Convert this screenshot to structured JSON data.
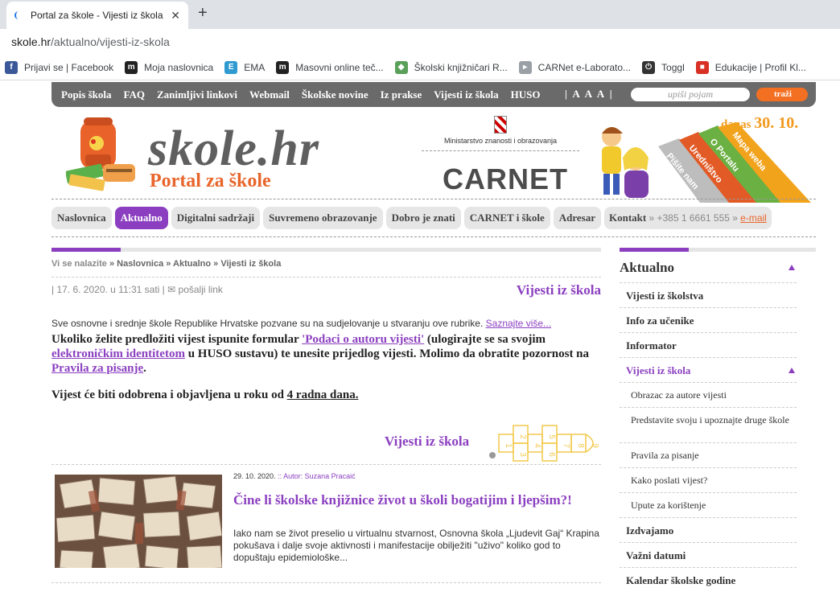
{
  "browser": {
    "tab_title": "Portal za škole - Vijesti iz škola",
    "close_glyph": "✕",
    "new_tab_glyph": "+",
    "url_host": "skole.hr",
    "url_path": "/aktualno/vijesti-iz-skola",
    "bookmarks": [
      {
        "label": "Prijavi se | Facebook",
        "icon": "facebook-icon",
        "color": "#3b5998",
        "glyph": "f"
      },
      {
        "label": "Moja naslovnica",
        "icon": "m-icon",
        "color": "#222222",
        "glyph": "m"
      },
      {
        "label": "EMA",
        "icon": "ema-icon",
        "color": "#2e9ad0",
        "glyph": "E"
      },
      {
        "label": "Masovni online teč...",
        "icon": "m-icon",
        "color": "#222222",
        "glyph": "m"
      },
      {
        "label": "Školski knjižničari R...",
        "icon": "shield-icon",
        "color": "#5aa05a",
        "glyph": "◆"
      },
      {
        "label": "CARNet e-Laborato...",
        "icon": "carnet-icon",
        "color": "#9aa0a6",
        "glyph": "▸"
      },
      {
        "label": "Toggl",
        "icon": "power-icon",
        "color": "#333333",
        "glyph": "⏻"
      },
      {
        "label": "Edukacije | Profil Kl...",
        "icon": "flag-icon",
        "color": "#d93025",
        "glyph": "■"
      }
    ]
  },
  "topnav": {
    "links": [
      "Popis škola",
      "FAQ",
      "Zanimljivi linkovi",
      "Webmail",
      "Školske novine",
      "Iz prakse",
      "Vijesti iz škola",
      "HUSO"
    ],
    "font_size": "| A A A |",
    "search_placeholder": "upiši pojam",
    "search_button": "traži"
  },
  "header": {
    "logo": "skole.hr",
    "subtitle": "Portal za škole",
    "ministry": "Ministarstvo znanosti i obrazovanja",
    "carnet": "CARNET",
    "date_prefix": "danas",
    "date": "30. 10.",
    "ribbons": [
      "Pišite nam",
      "Uredništvo",
      "O Portalu",
      "Mapa weba"
    ]
  },
  "mainnav": {
    "items": [
      "Naslovnica",
      "Aktualno",
      "Digitalni sadržaji",
      "Suvremeno obrazovanje",
      "Dobro je znati",
      "CARNET i škole",
      "Adresar"
    ],
    "active_index": 1,
    "kontakt_label": "Kontakt",
    "kontakt_phone": "» +385 1 6661 555 »",
    "kontakt_email": "e-mail"
  },
  "content": {
    "breadcrumb_label": "Vi se nalazite",
    "breadcrumb": "» Naslovnica » Aktualno » Vijesti iz škola",
    "dateline": "| 17. 6. 2020. u 11:31 sati |",
    "send_link": "pošalji link",
    "section_title": "Vijesti iz škola",
    "intro": "Sve osnovne i srednje škole Republike Hrvatske pozvane su na sudjelovanje u stvaranju ove rubrike.",
    "intro_link": "Saznajte više...",
    "p1_a": "Ukoliko želite predložiti vijest ispunite formular",
    "p1_link1": "'Podaci o autoru vijesti'",
    "p1_b": "(ulogirajte se sa svojim",
    "p1_link2": "elektroničkim identitetom",
    "p1_c": "u HUSO sustavu) te unesite prijedlog vijesti. Molimo da obratite pozornost na",
    "p1_link3": "Pravila za pisanje",
    "p1_d": ".",
    "p2_a": "Vijest će biti odobrena i objavljena u roku od",
    "p2_u": "4 radna dana.",
    "section_title2": "Vijesti iz škola",
    "hopscotch_numbers": [
      "1",
      "2",
      "3",
      "4",
      "5",
      "6",
      "7",
      "8",
      "9"
    ],
    "article": {
      "date": "29. 10. 2020.",
      "author": ":: Autor: Suzana Pracaić",
      "title": "Čine li školske knjižnice život u školi bogatijim i ljepšim?!",
      "text": "Iako nam se život preselio u virtualnu stvarnost, Osnovna škola „Ljudevit Gaj“ Krapina pokušava i dalje svoje aktivnosti i manifestacije obilježiti \"uživo\" koliko god to dopuštaju epidemiološke..."
    }
  },
  "sidebar": {
    "title": "Aktualno",
    "items": [
      {
        "label": "Vijesti iz školstva",
        "type": "item"
      },
      {
        "label": "Info za učenike",
        "type": "item"
      },
      {
        "label": "Informator",
        "type": "item"
      },
      {
        "label": "Vijesti iz škola",
        "type": "active"
      },
      {
        "label": "Obrazac za autore vijesti",
        "type": "sub"
      },
      {
        "label": "Predstavite svoju i upoznajte druge škole",
        "type": "sub2"
      },
      {
        "label": "Pravila za pisanje",
        "type": "sub"
      },
      {
        "label": "Kako poslati vijest?",
        "type": "sub"
      },
      {
        "label": "Upute za korištenje",
        "type": "sub"
      },
      {
        "label": "Izdvajamo",
        "type": "item"
      },
      {
        "label": "Važni datumi",
        "type": "item"
      },
      {
        "label": "Kalendar školske godine",
        "type": "item"
      }
    ]
  },
  "colors": {
    "accent": "#8b3fc0",
    "orange": "#e8662c",
    "date": "#f29a1e"
  }
}
